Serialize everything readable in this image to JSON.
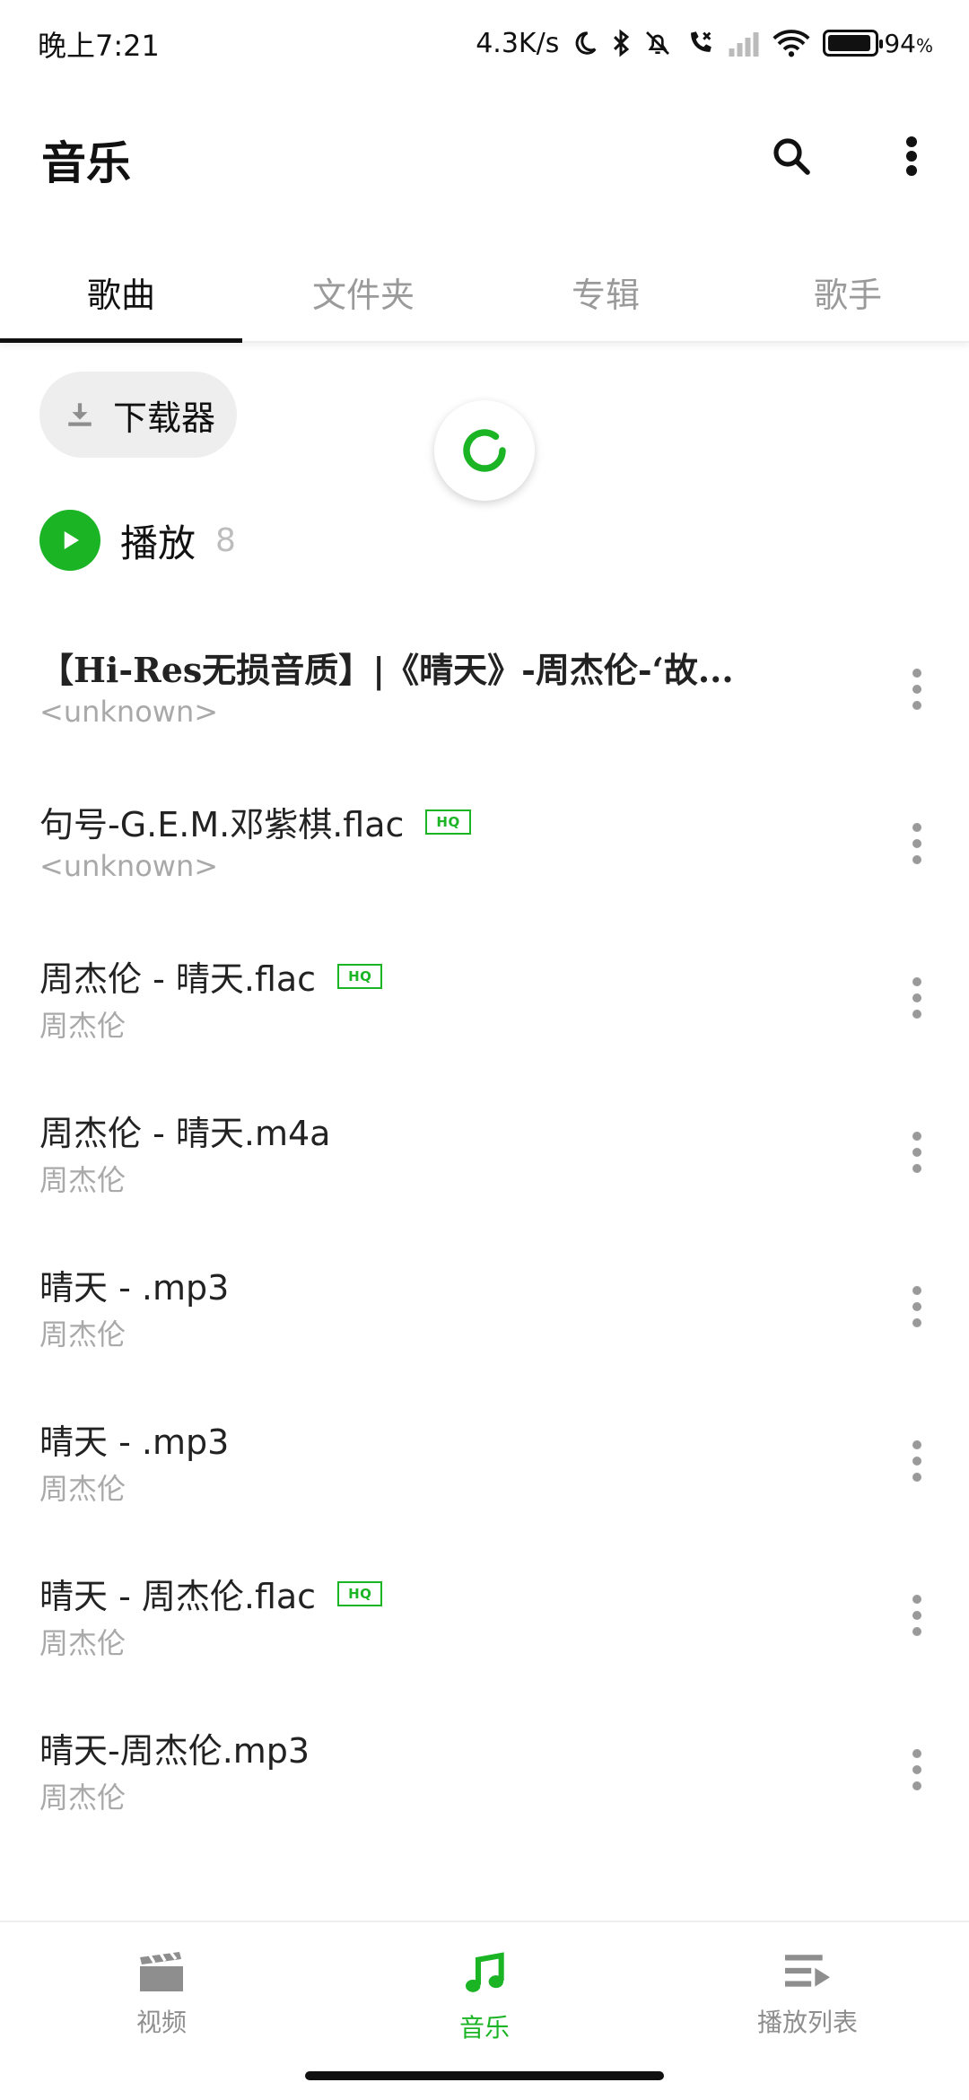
{
  "status_bar": {
    "time": "晚上7:21",
    "net_speed": "4.3K/s",
    "battery_percent": 94,
    "battery_label": "94",
    "battery_unit": "%"
  },
  "app_bar": {
    "title": "音乐",
    "icons": [
      "search-icon",
      "more-vert-icon"
    ]
  },
  "tabs": [
    {
      "label": "歌曲",
      "active": true
    },
    {
      "label": "文件夹",
      "active": false
    },
    {
      "label": "专辑",
      "active": false
    },
    {
      "label": "歌手",
      "active": false
    }
  ],
  "downloader": {
    "label": "下载器"
  },
  "play_all": {
    "label": "播放",
    "count": "8"
  },
  "songs": [
    {
      "title": "【Hi-Res无损音质】|《晴天》-周杰伦-‘故...",
      "artist": "<unknown>",
      "hq": false
    },
    {
      "title": "句号-G.E.M.邓紫棋.flac",
      "artist": "<unknown>",
      "hq": true
    },
    {
      "title": "周杰伦 - 晴天.flac",
      "artist": "周杰伦",
      "hq": true
    },
    {
      "title": "周杰伦 - 晴天.m4a",
      "artist": "周杰伦",
      "hq": false
    },
    {
      "title": "晴天 - .mp3",
      "artist": "周杰伦",
      "hq": false
    },
    {
      "title": "晴天 - .mp3",
      "artist": "周杰伦",
      "hq": false
    },
    {
      "title": "晴天 - 周杰伦.flac",
      "artist": "周杰伦",
      "hq": true
    },
    {
      "title": "晴天-周杰伦.mp3",
      "artist": "周杰伦",
      "hq": false
    }
  ],
  "hq_badge": "HQ",
  "bottom_nav": [
    {
      "label": "视频",
      "icon": "video-icon",
      "active": false
    },
    {
      "label": "音乐",
      "icon": "music-note-icon",
      "active": true
    },
    {
      "label": "播放列表",
      "icon": "playlist-icon",
      "active": false
    }
  ],
  "colors": {
    "accent": "#1ab424",
    "text_primary": "#222222",
    "text_secondary": "#a9a9a9",
    "inactive": "#8e8e8e"
  }
}
